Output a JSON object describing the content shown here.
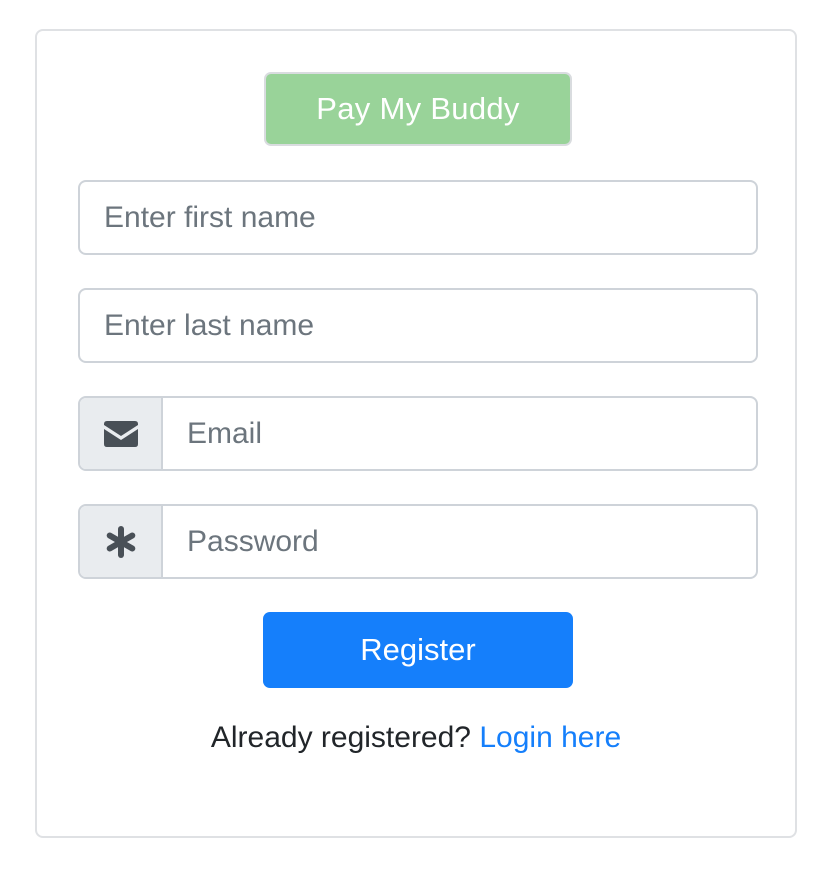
{
  "app": {
    "brand_label": "Pay My Buddy"
  },
  "form": {
    "first_name": {
      "placeholder": "Enter first name",
      "value": ""
    },
    "last_name": {
      "placeholder": "Enter last name",
      "value": ""
    },
    "email": {
      "placeholder": "Email",
      "value": "",
      "icon": "envelope-icon"
    },
    "password": {
      "placeholder": "Password",
      "value": "",
      "icon": "asterisk-icon"
    },
    "register_label": "Register"
  },
  "footer": {
    "prompt_text": "Already registered?",
    "login_link_text": "Login here"
  },
  "colors": {
    "brand_bg": "#99d399",
    "primary": "#157ffb",
    "addon_bg": "#e9ecef",
    "border": "#ced3d9"
  }
}
